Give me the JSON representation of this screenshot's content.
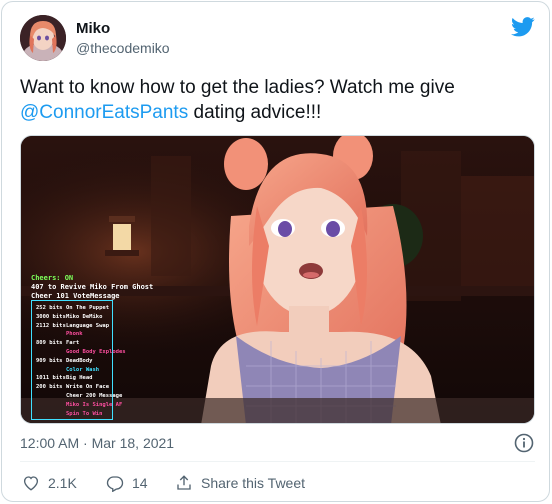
{
  "author": {
    "name": "Miko",
    "handle": "@thecodemiko"
  },
  "tweet": {
    "text_before": "Want to know how to get the ladies? Watch me give ",
    "mention": "@ConnorEatsPants",
    "text_after": " dating advice!!!"
  },
  "media": {
    "overlay": {
      "cheers": "Cheers: ON",
      "line1": "407 to Revive Miko From Ghost",
      "line2": "Cheer 101 VoteMessage",
      "items": [
        {
          "bits": "252 bits",
          "label": "On The Puppet",
          "color": "#ffffff"
        },
        {
          "bits": "3000 bits",
          "label": "Miko DeMiko",
          "color": "#ffffff"
        },
        {
          "bits": "2112 bits",
          "label": "Language Swap",
          "color": "#ffffff"
        },
        {
          "bits": "",
          "label": "Phonk",
          "color": "#ff4fa0"
        },
        {
          "bits": "809 bits",
          "label": "Fart",
          "color": "#ffffff"
        },
        {
          "bits": "",
          "label": "Good Body Explodes",
          "color": "#ff4fa0"
        },
        {
          "bits": "909 bits",
          "label": "DeadBody",
          "color": "#ffffff"
        },
        {
          "bits": "",
          "label": "Color Wash",
          "color": "#40e0ff"
        },
        {
          "bits": "1011 bits",
          "label": "Big Head",
          "color": "#ffffff"
        },
        {
          "bits": "200 bits",
          "label": "Write On Face",
          "color": "#ffffff"
        },
        {
          "bits": "",
          "label": "Cheer 200 Message",
          "color": "#ffffff"
        },
        {
          "bits": "",
          "label": "Miko Is Single AF",
          "color": "#ff4fa0"
        },
        {
          "bits": "",
          "label": "Spin To Win",
          "color": "#ff4fa0"
        }
      ]
    }
  },
  "meta": {
    "timestamp": "12:00 AM · Mar 18, 2021"
  },
  "actions": {
    "likes": "2.1K",
    "replies": "14",
    "share_label": "Share this Tweet"
  },
  "icons": {
    "brand": "twitter-bird-icon",
    "info": "info-icon",
    "like": "heart-icon",
    "reply": "reply-icon",
    "share": "share-icon"
  },
  "colors": {
    "brand": "#1d9bf0",
    "text": "#0f1419",
    "secondary": "#536471"
  }
}
